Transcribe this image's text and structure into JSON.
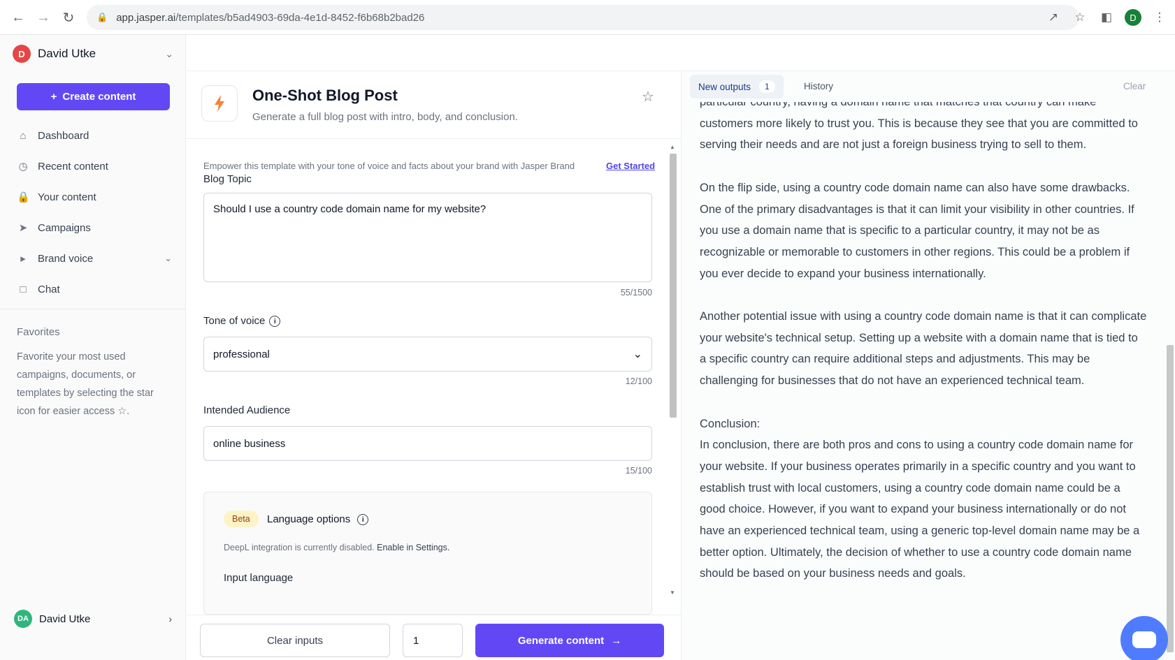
{
  "browser": {
    "url_domain": "app.jasper.ai",
    "url_path": "/templates/b5ad4903-69da-4e1d-8452-f6b68b2bad26",
    "profile_initial": "D"
  },
  "sidebar": {
    "user_name": "David Utke",
    "user_initial": "D",
    "create_label": "Create content",
    "items": [
      {
        "label": "Dashboard",
        "icon": "home-icon"
      },
      {
        "label": "Recent content",
        "icon": "clock-icon"
      },
      {
        "label": "Your content",
        "icon": "lock-icon"
      },
      {
        "label": "Campaigns",
        "icon": "rocket-icon"
      },
      {
        "label": "Brand voice",
        "icon": "megaphone-icon"
      },
      {
        "label": "Chat",
        "icon": "chat-icon"
      }
    ],
    "favorites_title": "Favorites",
    "favorites_desc": "Favorite your most used campaigns, documents, or templates by selecting the star icon for easier access",
    "bottom_user_initials": "DA",
    "bottom_user_name": "David Utke"
  },
  "template": {
    "title": "One-Shot Blog Post",
    "subtitle": "Generate a full blog post with intro, body, and conclusion.",
    "brand_note": "Empower this template with your tone of voice and facts about your brand with Jasper Brand",
    "get_started": "Get Started",
    "blog_topic_label": "Blog Topic",
    "blog_topic_value": "Should I use a country code domain name for my website?",
    "blog_topic_count": "55/1500",
    "tone_label": "Tone of voice",
    "tone_value": "professional",
    "tone_count": "12/100",
    "audience_label": "Intended Audience",
    "audience_value": "online business",
    "audience_count": "15/100",
    "beta_label": "Beta",
    "language_title": "Language options",
    "deepl_note": "DeepL integration is currently disabled.",
    "deepl_enable": "Enable in Settings.",
    "input_language_label": "Input language",
    "clear_inputs": "Clear inputs",
    "output_count": "1",
    "generate_label": "Generate content"
  },
  "output": {
    "tab_new": "New outputs",
    "tab_new_count": "1",
    "tab_history": "History",
    "clear": "Clear",
    "paragraphs": [
      "particular country, having a domain name that matches that country can make customers more likely to trust you. This is because they see that you are committed to serving their needs and are not just a foreign business trying to sell to them.",
      "On the flip side, using a country code domain name can also have some drawbacks. One of the primary disadvantages is that it can limit your visibility in other countries. If you use a domain name that is specific to a particular country, it may not be as recognizable or memorable to customers in other regions. This could be a problem if you ever decide to expand your business internationally.",
      "Another potential issue with using a country code domain name is that it can complicate your website's technical setup. Setting up a website with a domain name that is tied to a specific country can require additional steps and adjustments. This may be challenging for businesses that do not have an experienced technical team."
    ],
    "conclusion_heading": "Conclusion:",
    "conclusion_text": "In conclusion, there are both pros and cons to using a country code domain name for your website. If your business operates primarily in a specific country and you want to establish trust with local customers, using a country code domain name could be a good choice. However, if you want to expand your business internationally or do not have an experienced technical team, using a generic top-level domain name may be a better option. Ultimately, the decision of whether to use a country code domain name should be based on your business needs and goals."
  }
}
